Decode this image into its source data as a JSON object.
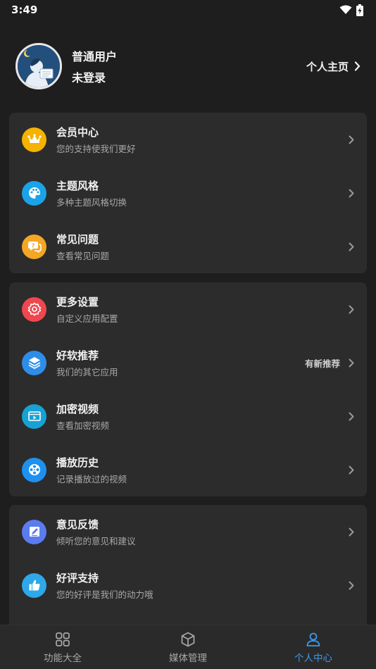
{
  "status_bar": {
    "time": "3:49",
    "icons": [
      "wifi-icon",
      "battery-charging-icon"
    ]
  },
  "profile": {
    "name": "普通用户",
    "login_status": "未登录",
    "homepage_label": "个人主页"
  },
  "groups": [
    {
      "items": [
        {
          "title": "会员中心",
          "subtitle": "您的支持使我们更好",
          "icon": "crown-icon",
          "color": "#f5b300"
        },
        {
          "title": "主题风格",
          "subtitle": "多种主题风格切换",
          "icon": "palette-icon",
          "color": "#1aa3e8"
        },
        {
          "title": "常见问题",
          "subtitle": "查看常见问题",
          "icon": "question-chat-icon",
          "color": "#f5a623"
        }
      ]
    },
    {
      "items": [
        {
          "title": "更多设置",
          "subtitle": "自定义应用配置",
          "icon": "gear-icon",
          "color": "#f0474f"
        },
        {
          "title": "好软推荐",
          "subtitle": "我们的其它应用",
          "icon": "layers-icon",
          "color": "#2e8de8",
          "badge": "有新推荐"
        },
        {
          "title": "加密视频",
          "subtitle": "查看加密视频",
          "icon": "video-icon",
          "color": "#17a2d6"
        },
        {
          "title": "播放历史",
          "subtitle": "记录播放过的视频",
          "icon": "film-reel-icon",
          "color": "#1e90f0"
        }
      ]
    },
    {
      "items": [
        {
          "title": "意见反馈",
          "subtitle": "倾听您的意见和建议",
          "icon": "edit-icon",
          "color": "#5b7cf0"
        },
        {
          "title": "好评支持",
          "subtitle": "您的好评是我们的动力哦",
          "icon": "thumbs-up-icon",
          "color": "#2ea8e8"
        }
      ]
    }
  ],
  "tabs": [
    {
      "label": "功能大全",
      "icon": "grid-icon",
      "active": false
    },
    {
      "label": "媒体管理",
      "icon": "box-icon",
      "active": false
    },
    {
      "label": "个人中心",
      "icon": "user-icon",
      "active": true
    }
  ],
  "colors": {
    "accent": "#3b9af0",
    "background": "#1e1e1e",
    "card": "#2c2c2c"
  }
}
